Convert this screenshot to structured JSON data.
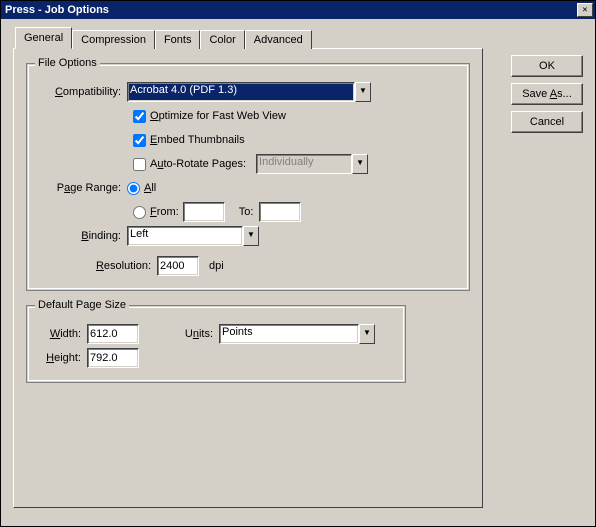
{
  "window": {
    "title": "Press - Job Options"
  },
  "tabs": [
    "General",
    "Compression",
    "Fonts",
    "Color",
    "Advanced"
  ],
  "buttons": {
    "ok": "OK",
    "saveas": "Save As...",
    "cancel": "Cancel"
  },
  "file_options": {
    "legend": "File Options",
    "compat_label": "Compatibility:",
    "compat_value": "Acrobat 4.0 (PDF 1.3)",
    "optimize": "Optimize for Fast Web View",
    "embed": "Embed Thumbnails",
    "autorotate": "Auto-Rotate Pages:",
    "autorotate_value": "Individually",
    "pagerange_label": "Page Range:",
    "all": "All",
    "from": "From:",
    "to": "To:",
    "binding_label": "Binding:",
    "binding_value": "Left",
    "resolution_label": "Resolution:",
    "resolution_value": "2400",
    "resolution_unit": "dpi"
  },
  "default_page": {
    "legend": "Default Page Size",
    "width_label": "Width:",
    "width_value": "612.0",
    "units_label": "Units:",
    "units_value": "Points",
    "height_label": "Height:",
    "height_value": "792.0"
  }
}
